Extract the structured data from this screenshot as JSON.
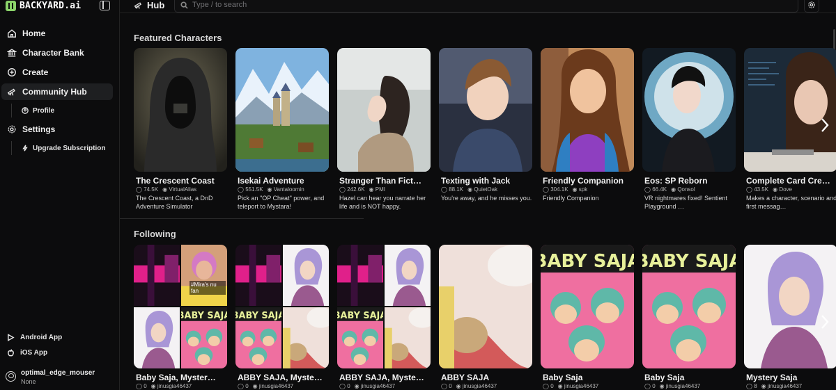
{
  "app": {
    "logo_text": "BACKYARD.ai"
  },
  "sidebar": {
    "items": [
      {
        "label": "Home",
        "icon": "home-icon"
      },
      {
        "label": "Character Bank",
        "icon": "bank-icon"
      },
      {
        "label": "Create",
        "icon": "plus-circle-icon"
      },
      {
        "label": "Community Hub",
        "icon": "telescope-icon",
        "active": true
      },
      {
        "label": "Settings",
        "icon": "gear-icon"
      }
    ],
    "sub_items": {
      "profile": "Profile",
      "upgrade": "Upgrade Subscription"
    },
    "bottom_links": {
      "android": "Android App",
      "ios": "iOS App"
    },
    "user": {
      "name": "optimal_edge_mouser",
      "status": "None"
    }
  },
  "header": {
    "title": "Hub",
    "search_placeholder": "Type / to search"
  },
  "featured": {
    "title": "Featured Characters",
    "cards": [
      {
        "title": "The Crescent Coast",
        "chats": "74.5K",
        "author": "VirtualAlias",
        "desc": "The Crescent Coast, a DnD Adventure Simulator",
        "art": "hood"
      },
      {
        "title": "Isekai Adventure",
        "chats": "551.5K",
        "author": "Vantaloomin",
        "desc": "Pick an \"OP Cheat\" power, and teleport to Mystara!",
        "art": "castle"
      },
      {
        "title": "Stranger Than Fict…",
        "chats": "242.6K",
        "author": "PMI",
        "desc": "Hazel can hear you narrate her life and is NOT happy.",
        "art": "girl"
      },
      {
        "title": "Texting with Jack",
        "chats": "88.1K",
        "author": "QuietOak",
        "desc": "You're away, and he misses you.",
        "art": "jack"
      },
      {
        "title": "Friendly Companion",
        "chats": "304.1K",
        "author": "spk",
        "desc": "Friendly Companion",
        "art": "companion"
      },
      {
        "title": "Eos: SP Reborn",
        "chats": "66.4K",
        "author": "Qonsol",
        "desc": "VR nightmares fixed! Sentient Playground …",
        "art": "eos"
      },
      {
        "title": "Complete Card Cre…",
        "chats": "43.5K",
        "author": "Dove",
        "desc": "Makes a character, scenario and first messag…",
        "art": "card"
      }
    ]
  },
  "following": {
    "title": "Following",
    "cards": [
      {
        "title": "Baby Saja, Myster…",
        "chats": "0",
        "author": "jinusgia46437",
        "art": "mosaic1",
        "caption": "#Mira's nu fan"
      },
      {
        "title": "ABBY SAJA, Myste…",
        "chats": "0",
        "author": "jinusgia46437",
        "art": "mosaic2"
      },
      {
        "title": "ABBY SAJA, Myste…",
        "chats": "0",
        "author": "jinusgia46437",
        "art": "mosaic2"
      },
      {
        "title": "ABBY SAJA",
        "chats": "0",
        "author": "jinusgia46437",
        "art": "blur"
      },
      {
        "title": "Baby Saja",
        "chats": "0",
        "author": "jinusgia46437",
        "art": "saja",
        "art_text": "BABY SAJA"
      },
      {
        "title": "Baby Saja",
        "chats": "0",
        "author": "jinusgia46437",
        "art": "saja",
        "art_text": "BABY SAJA"
      },
      {
        "title": "Mystery Saja",
        "chats": "8",
        "author": "jinusgia46437",
        "art": "mystery"
      }
    ]
  },
  "colors": {
    "background": "#0c0c0d",
    "accent": "#8bd46a",
    "active_nav": "#1e1f21"
  }
}
